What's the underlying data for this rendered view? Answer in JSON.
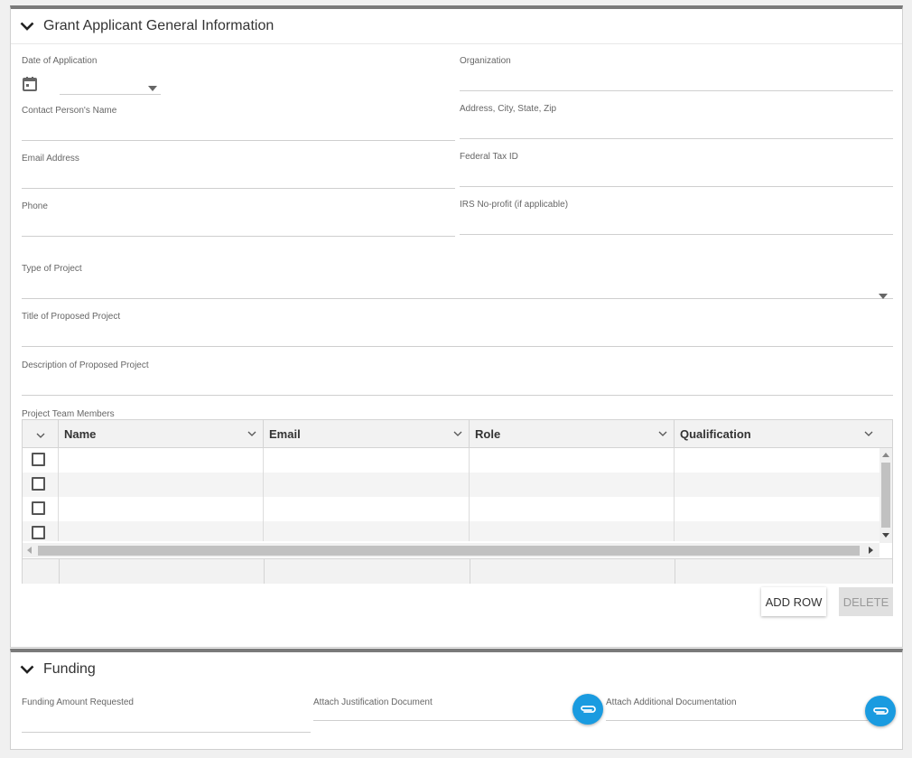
{
  "general": {
    "title": "Grant Applicant General Information",
    "date_label": "Date of Application",
    "organization_label": "Organization",
    "contact_label": "Contact Person's Name",
    "address_label": "Address, City, State, Zip",
    "email_label": "Email Address",
    "tax_label": "Federal Tax ID",
    "phone_label": "Phone",
    "irs_label": "IRS No-profit (if applicable)",
    "project_type_label": "Type of Project",
    "project_title_label": "Title of Proposed Project",
    "description_label": "Description of Proposed Project",
    "team_label": "Project Team Members",
    "columns": [
      "Name",
      "Email",
      "Role",
      "Qualification"
    ],
    "add_row_label": "ADD ROW",
    "delete_label": "DELETE"
  },
  "funding": {
    "title": "Funding",
    "amount_label": "Funding Amount Requested",
    "justification_label": "Attach Justification Document",
    "additional_label": "Attach Additional Documentation"
  },
  "colors": {
    "accent": "#1a9be0",
    "panel_border": "#7a7a7a"
  },
  "icons": [
    "chevron-down-icon",
    "calendar-icon",
    "dropdown-arrow-icon",
    "paperclip-icon"
  ]
}
